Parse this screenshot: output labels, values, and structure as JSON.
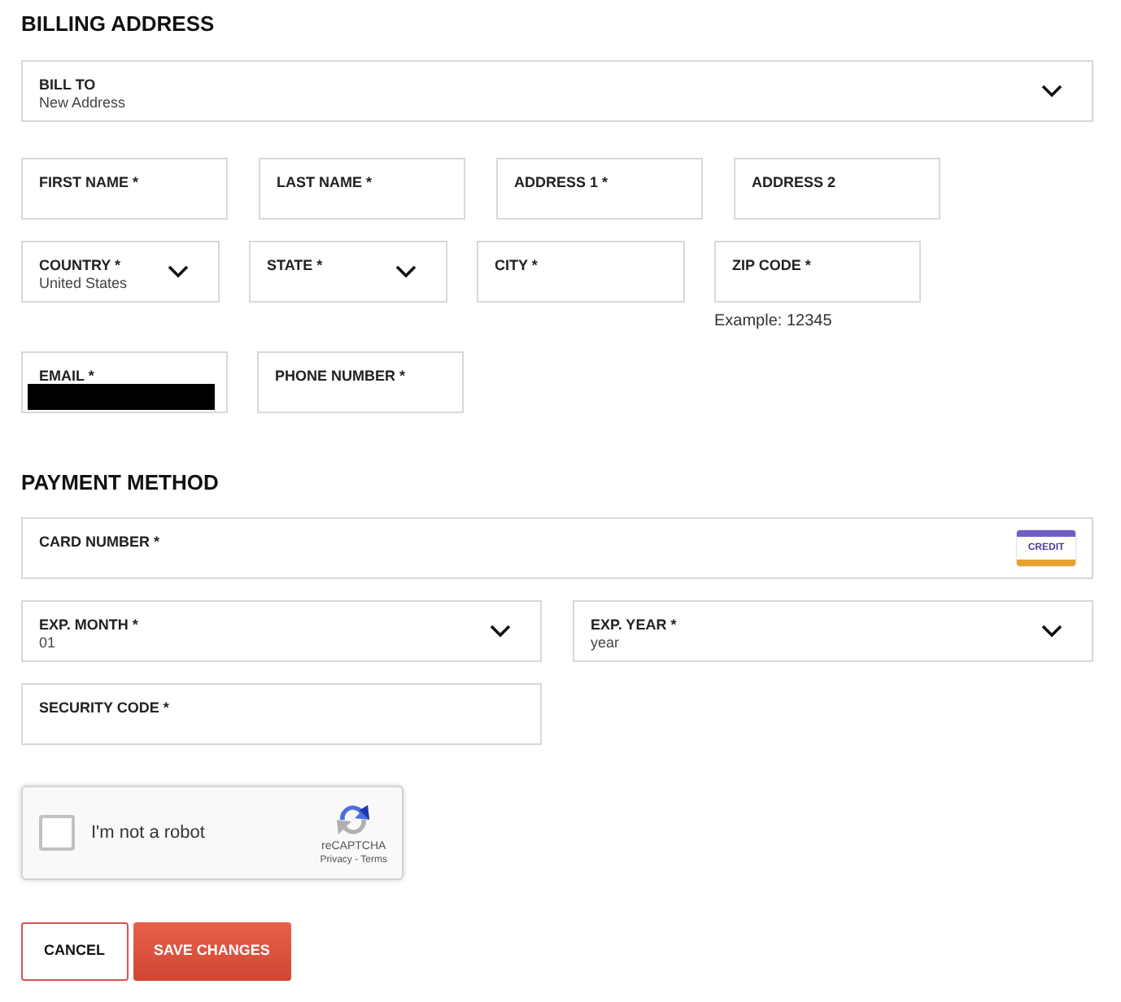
{
  "billing": {
    "title": "BILLING ADDRESS",
    "rows": [
      [
        {
          "kind": "select",
          "label": "BILL TO",
          "value": "New Address"
        }
      ],
      [
        {
          "kind": "text",
          "label": "FIRST NAME *"
        },
        {
          "kind": "text",
          "label": "LAST NAME *"
        },
        {
          "kind": "text",
          "label": "ADDRESS 1 *"
        },
        {
          "kind": "text",
          "label": "ADDRESS 2"
        }
      ],
      [
        {
          "kind": "select",
          "label": "COUNTRY *",
          "value": "United States"
        },
        {
          "kind": "select",
          "label": "STATE *"
        },
        {
          "kind": "text",
          "label": "CITY *"
        },
        {
          "kind": "text",
          "label": "ZIP CODE *",
          "hint": "Example: 12345"
        }
      ],
      [
        {
          "kind": "text",
          "label": "EMAIL *",
          "redacted": true
        },
        {
          "kind": "text",
          "label": "PHONE NUMBER *"
        }
      ]
    ]
  },
  "payment": {
    "title": "PAYMENT METHOD",
    "rows": [
      [
        {
          "kind": "card",
          "label": "CARD NUMBER *",
          "badge": "CREDIT"
        }
      ],
      [
        {
          "kind": "select",
          "label": "EXP. MONTH *",
          "value": "01"
        },
        {
          "kind": "select",
          "label": "EXP. YEAR *",
          "value": "year"
        }
      ],
      [
        {
          "kind": "text",
          "label": "SECURITY CODE *"
        }
      ]
    ]
  },
  "captcha": {
    "checked": false,
    "label": "I'm not a robot",
    "brand": "reCAPTCHA",
    "links": "Privacy - Terms"
  },
  "buttons": [
    {
      "kind": "secondary",
      "label": "CANCEL"
    },
    {
      "kind": "primary",
      "label": "SAVE CHANGES"
    }
  ]
}
